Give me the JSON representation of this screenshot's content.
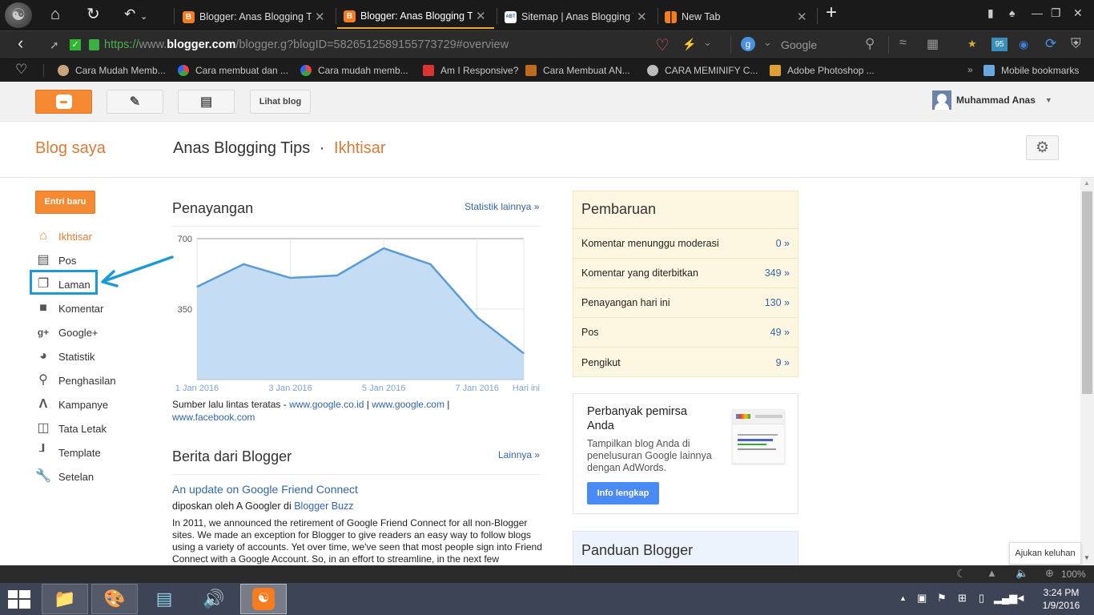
{
  "browser": {
    "tabs": [
      {
        "title": "Blogger: Anas Blogging Tips",
        "favicon": "blogger-icon",
        "active": false
      },
      {
        "title": "Blogger: Anas Blogging Tips",
        "favicon": "blogger-icon",
        "active": true
      },
      {
        "title": "Sitemap | Anas Blogging Tips",
        "favicon": "abt-icon",
        "active": false
      },
      {
        "title": "New Tab",
        "favicon": "new-tab-icon",
        "active": false
      }
    ],
    "url": {
      "scheme": "https://",
      "prefix": "www.",
      "domain": "blogger.com",
      "path": "/blogger.g?blogID=5826512589155773729#overview"
    },
    "search_engine": "Google",
    "addon_badge": "95",
    "bookmarks": [
      "Cara Mudah Memb...",
      "Cara membuat dan ...",
      "Cara mudah memb...",
      "Am I Responsive?",
      "Cara Membuat AN...",
      "CARA MEMINIFY C...",
      "Adobe Photoshop ..."
    ],
    "mobile_bookmarks": "Mobile bookmarks",
    "zoom_level": "100%"
  },
  "header": {
    "view_blog": "Lihat blog",
    "user_name": "Muhammad Anas"
  },
  "title": {
    "my_blogs": "Blog saya",
    "blog_name": "Anas Blogging Tips",
    "separator": "·",
    "section": "Ikhtisar"
  },
  "sidebar": {
    "new_post": "Entri baru",
    "items": [
      {
        "label": "Ikhtisar",
        "icon": "home-icon",
        "active": true
      },
      {
        "label": "Pos",
        "icon": "posts-icon"
      },
      {
        "label": "Laman",
        "icon": "pages-icon",
        "highlighted": true
      },
      {
        "label": "Komentar",
        "icon": "comment-icon"
      },
      {
        "label": "Google+",
        "icon": "google-plus-icon"
      },
      {
        "label": "Statistik",
        "icon": "pie-chart-icon"
      },
      {
        "label": "Penghasilan",
        "icon": "trophy-icon"
      },
      {
        "label": "Kampanye",
        "icon": "adwords-icon"
      },
      {
        "label": "Tata Letak",
        "icon": "layout-icon"
      },
      {
        "label": "Template",
        "icon": "paint-roller-icon"
      },
      {
        "label": "Setelan",
        "icon": "wrench-icon"
      }
    ]
  },
  "pageviews": {
    "heading": "Penayangan",
    "more_link": "Statistik lainnya »",
    "traffic_label": "Sumber lalu lintas teratas - ",
    "traffic_sources": [
      "www.google.co.id",
      "www.google.com",
      "www.facebook.com"
    ],
    "traffic_sep": " | "
  },
  "chart_data": {
    "type": "area",
    "title": "Penayangan",
    "x": [
      "1 Jan 2016",
      "2 Jan 2016",
      "3 Jan 2016",
      "4 Jan 2016",
      "5 Jan 2016",
      "6 Jan 2016",
      "7 Jan 2016",
      "Hari ini"
    ],
    "x_tick_labels": [
      "1 Jan 2016",
      "3 Jan 2016",
      "5 Jan 2016",
      "7 Jan 2016",
      "Hari ini"
    ],
    "x_tick_indices": [
      0,
      2,
      4,
      6,
      7
    ],
    "series": [
      {
        "name": "Penayangan",
        "values": [
          461,
          573,
          505,
          517,
          652,
          573,
          310,
          130
        ]
      }
    ],
    "y_ticks": [
      350,
      700
    ],
    "ylim": [
      0,
      700
    ],
    "grid": true,
    "colors": {
      "line": "#5b9bd5",
      "fill": "#c5ddf4",
      "grid": "#e6e6e6"
    }
  },
  "news": {
    "heading": "Berita dari Blogger",
    "more_link": "Lainnya »",
    "post_title": "An update on Google Friend Connect",
    "byline_prefix": "diposkan oleh A Googler di ",
    "byline_source": "Blogger Buzz",
    "body": "In 2011, we announced the retirement of Google Friend Connect for all non-Blogger sites. We made an exception for Blogger to give readers an easy way to follow blogs using a variety of accounts. Yet over time, we've seen that most people sign into Friend Connect with a Google Account. So, in an effort to streamline, in the next few"
  },
  "updates": {
    "heading": "Pembaruan",
    "rows": [
      {
        "label": "Komentar menunggu moderasi",
        "value": "0 »"
      },
      {
        "label": "Komentar yang diterbitkan",
        "value": "349 »"
      },
      {
        "label": "Penayangan hari ini",
        "value": "130 »"
      },
      {
        "label": "Pos",
        "value": "49 »"
      },
      {
        "label": "Pengikut",
        "value": "9 »"
      }
    ]
  },
  "promo": {
    "title": "Perbanyak pemirsa Anda",
    "desc": "Tampilkan blog Anda di penelusuran Google lainnya dengan AdWords.",
    "button": "Info lengkap"
  },
  "guide": {
    "heading": "Panduan Blogger"
  },
  "feedback": "Ajukan keluhan",
  "taskbar": {
    "apps": [
      "file-explorer",
      "paint",
      "notepad",
      "volume-mixer",
      "uc-browser"
    ],
    "time": "3:24 PM",
    "date": "1/9/2016"
  }
}
